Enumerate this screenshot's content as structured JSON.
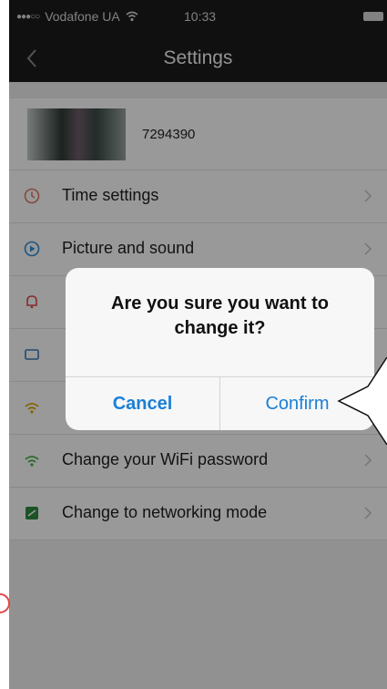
{
  "status_bar": {
    "signal_dots": "●●●○○",
    "carrier": "Vodafone UA",
    "time": "10:33",
    "wifi_icon": "wifi-icon",
    "battery_icon": "battery-icon"
  },
  "nav": {
    "back_icon": "chevron-left-icon",
    "title": "Settings"
  },
  "device": {
    "id": "7294390",
    "thumbnail_icon": "camera-thumbnail"
  },
  "settings_items": [
    {
      "label": "Time settings",
      "icon": "clock-icon",
      "color": "#e07a5f"
    },
    {
      "label": "Picture and sound",
      "icon": "play-circle-icon",
      "color": "#2f8fd8"
    },
    {
      "label": "",
      "icon": "bell-icon",
      "color": "#e04848"
    },
    {
      "label": "",
      "icon": "card-icon",
      "color": "#3a7ab8"
    },
    {
      "label": "",
      "icon": "wifi-icon",
      "color": "#e0a400"
    },
    {
      "label": "Change your WiFi password",
      "icon": "wifi-icon",
      "color": "#3db34a"
    },
    {
      "label": "Change to networking mode",
      "icon": "network-mode-icon",
      "color": "#2e8b3e"
    }
  ],
  "dialog": {
    "message": "Are you sure you want to change it?",
    "cancel_label": "Cancel",
    "confirm_label": "Confirm"
  },
  "colors": {
    "nav_background": "#1c1c1c",
    "accent": "#1a7fd8"
  }
}
